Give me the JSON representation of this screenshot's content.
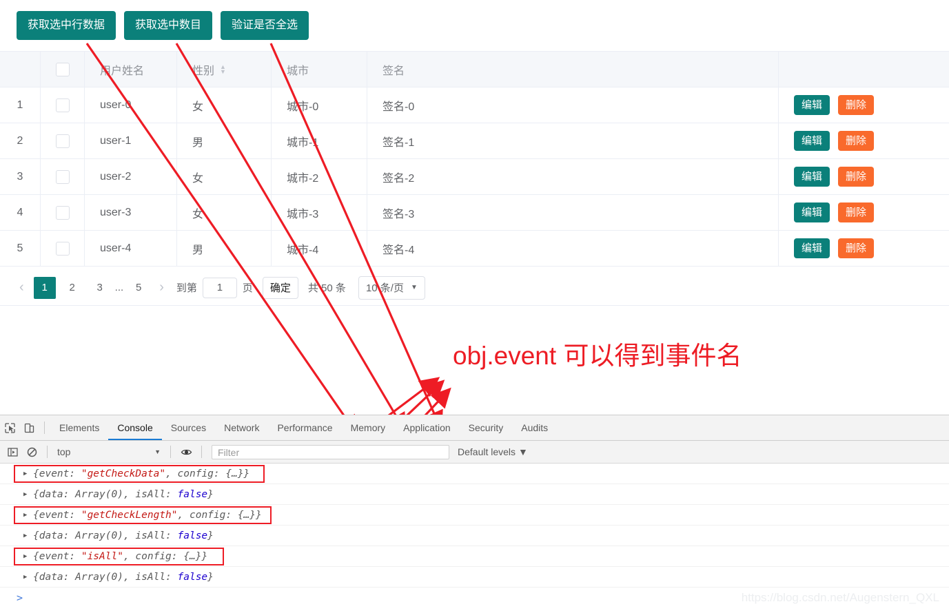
{
  "toolbar": {
    "buttons": [
      {
        "label": "获取选中行数据",
        "name": "get-check-data-button"
      },
      {
        "label": "获取选中数目",
        "name": "get-check-length-button"
      },
      {
        "label": "验证是否全选",
        "name": "is-all-button"
      }
    ]
  },
  "table": {
    "headers": {
      "index": "",
      "checkbox": "",
      "name": "用户姓名",
      "sex": "性别",
      "city": "城市",
      "sign": "签名",
      "ops": ""
    },
    "rows": [
      {
        "index": "1",
        "name": "user-0",
        "sex": "女",
        "city": "城市-0",
        "sign": "签名-0"
      },
      {
        "index": "2",
        "name": "user-1",
        "sex": "男",
        "city": "城市-1",
        "sign": "签名-1"
      },
      {
        "index": "3",
        "name": "user-2",
        "sex": "女",
        "city": "城市-2",
        "sign": "签名-2"
      },
      {
        "index": "4",
        "name": "user-3",
        "sex": "女",
        "city": "城市-3",
        "sign": "签名-3"
      },
      {
        "index": "5",
        "name": "user-4",
        "sex": "男",
        "city": "城市-4",
        "sign": "签名-4"
      }
    ],
    "op_edit_label": "编辑",
    "op_delete_label": "删除"
  },
  "pagination": {
    "prev": "‹",
    "next": "›",
    "pages": [
      "1",
      "2",
      "3"
    ],
    "ellipsis": "...",
    "last_page": "5",
    "active_page": "1",
    "goto_label": "到第",
    "goto_value": "1",
    "page_unit": "页",
    "confirm_label": "确定",
    "total_label": "共 50 条",
    "page_size": "10 条/页",
    "caret": "▼"
  },
  "annotation": {
    "text": "obj.event 可以得到事件名",
    "color": "#ed1c24"
  },
  "devtools": {
    "icons": [
      "inspect-element-icon",
      "device-toolbar-icon"
    ],
    "tabs": [
      {
        "label": "Elements",
        "selected": false
      },
      {
        "label": "Console",
        "selected": true
      },
      {
        "label": "Sources",
        "selected": false
      },
      {
        "label": "Network",
        "selected": false
      },
      {
        "label": "Performance",
        "selected": false
      },
      {
        "label": "Memory",
        "selected": false
      },
      {
        "label": "Application",
        "selected": false
      },
      {
        "label": "Security",
        "selected": false
      },
      {
        "label": "Audits",
        "selected": false
      }
    ],
    "filter_bar": {
      "context": "top",
      "context_caret": "▼",
      "filter_placeholder": "Filter",
      "levels": "Default levels",
      "levels_caret": "▼"
    },
    "logs": [
      {
        "triangle": "▶",
        "highlighted": true,
        "parts": [
          {
            "t": "{event: ",
            "c": "plain"
          },
          {
            "t": "\"getCheckData\"",
            "c": "str"
          },
          {
            "t": ", config: {…}}",
            "c": "plain"
          }
        ]
      },
      {
        "triangle": "▶",
        "highlighted": false,
        "parts": [
          {
            "t": "{data: Array(0), isAll: ",
            "c": "plain"
          },
          {
            "t": "false",
            "c": "kw"
          },
          {
            "t": "}",
            "c": "plain"
          }
        ]
      },
      {
        "triangle": "▶",
        "highlighted": true,
        "parts": [
          {
            "t": "{event: ",
            "c": "plain"
          },
          {
            "t": "\"getCheckLength\"",
            "c": "str"
          },
          {
            "t": ", config: {…}}",
            "c": "plain"
          }
        ]
      },
      {
        "triangle": "▶",
        "highlighted": false,
        "parts": [
          {
            "t": "{data: Array(0), isAll: ",
            "c": "plain"
          },
          {
            "t": "false",
            "c": "kw"
          },
          {
            "t": "}",
            "c": "plain"
          }
        ]
      },
      {
        "triangle": "▶",
        "highlighted": true,
        "parts": [
          {
            "t": "{event: ",
            "c": "plain"
          },
          {
            "t": "\"isAll\"",
            "c": "str"
          },
          {
            "t": ", config: {…}}",
            "c": "plain"
          }
        ]
      },
      {
        "triangle": "▶",
        "highlighted": false,
        "parts": [
          {
            "t": "{data: Array(0), isAll: ",
            "c": "plain"
          },
          {
            "t": "false",
            "c": "kw"
          },
          {
            "t": "}",
            "c": "plain"
          }
        ]
      }
    ],
    "prompt": ">"
  },
  "watermark": "https://blog.csdn.net/Augenstern_QXL",
  "colors": {
    "teal": "#0b807a",
    "orange": "#f96a2c",
    "annotation_red": "#ed1c24",
    "box_red": "#ee1c25"
  }
}
